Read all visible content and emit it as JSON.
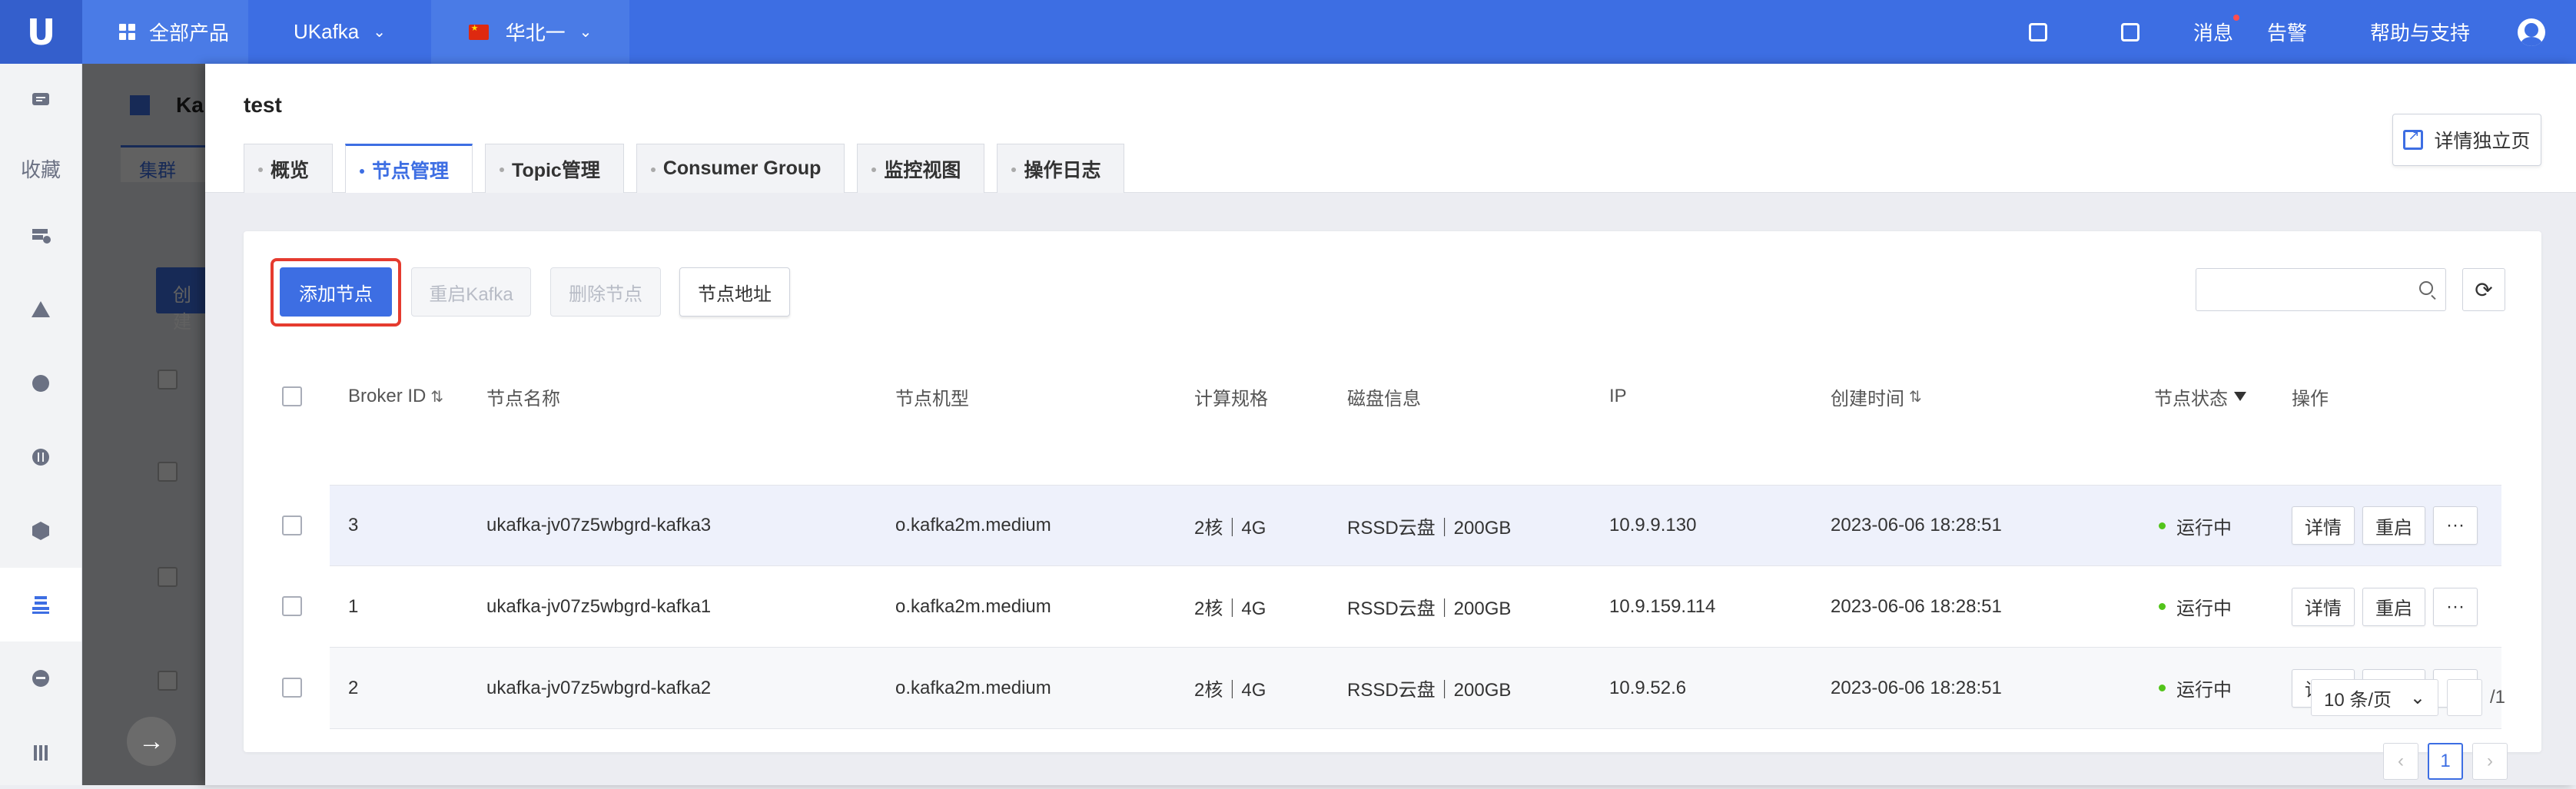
{
  "topbar": {
    "all_products": "全部产品",
    "product": "UKafka",
    "region": "华北一",
    "messages": "消息",
    "alerts": "告警",
    "help": "帮助与支持"
  },
  "sidebar": {
    "favorites": "收藏"
  },
  "background": {
    "title": "Ka",
    "tab": "集群",
    "button": "创建"
  },
  "drawer": {
    "title": "test",
    "tabs": [
      "概览",
      "节点管理",
      "Topic管理",
      "Consumer Group",
      "监控视图",
      "操作日志"
    ],
    "active_tab": "节点管理",
    "detail_page": "详情独立页"
  },
  "toolbar": {
    "add_node": "添加节点",
    "restart_kafka": "重启Kafka",
    "delete_node": "删除节点",
    "node_address": "节点地址"
  },
  "table": {
    "headers": [
      "Broker ID",
      "节点名称",
      "节点机型",
      "计算规格",
      "磁盘信息",
      "IP",
      "创建时间",
      "节点状态",
      "操作"
    ],
    "rows": [
      {
        "id": "3",
        "name": "ukafka-jv07z5wbgrd-kafka3",
        "type": "o.kafka2m.medium",
        "spec": "2核｜4G",
        "disk": "RSSD云盘｜200GB",
        "ip": "10.9.9.130",
        "created": "2023-06-06 18:28:51",
        "status": "运行中"
      },
      {
        "id": "1",
        "name": "ukafka-jv07z5wbgrd-kafka1",
        "type": "o.kafka2m.medium",
        "spec": "2核｜4G",
        "disk": "RSSD云盘｜200GB",
        "ip": "10.9.159.114",
        "created": "2023-06-06 18:28:51",
        "status": "运行中"
      },
      {
        "id": "2",
        "name": "ukafka-jv07z5wbgrd-kafka2",
        "type": "o.kafka2m.medium",
        "spec": "2核｜4G",
        "disk": "RSSD云盘｜200GB",
        "ip": "10.9.52.6",
        "created": "2023-06-06 18:28:51",
        "status": "运行中"
      }
    ],
    "row_actions": {
      "detail": "详情",
      "restart": "重启",
      "more": "···"
    }
  },
  "pagination": {
    "current": "1",
    "page_size": "10 条/页",
    "total_pages": "/1",
    "prev": "‹",
    "next": "›"
  }
}
